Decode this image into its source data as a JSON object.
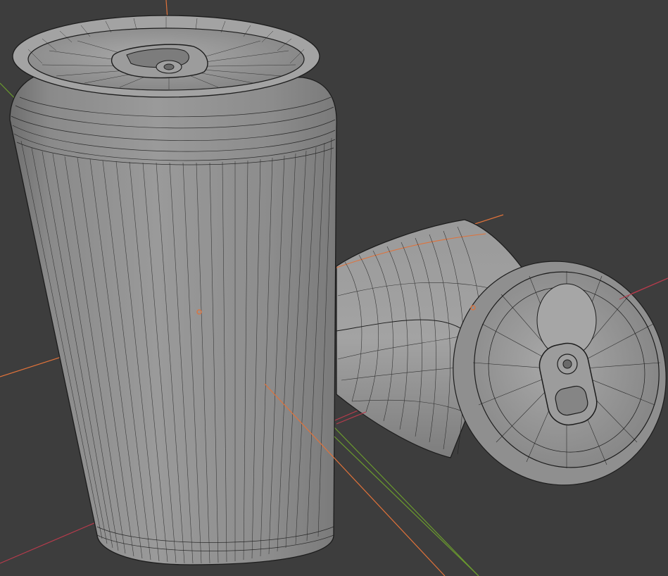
{
  "viewport": {
    "background": "#3d3d3d",
    "axis_colors": {
      "x_axis": "#b63b4c",
      "y_axis": "#6a9a2e",
      "object_axis": "#e0723a"
    },
    "mesh_fill": "#8f8f8f",
    "wire_color": "#1c1c1c",
    "origin_color": "#e0723a"
  },
  "scene": {
    "objects": [
      {
        "name": "upright-can",
        "orientation": "standing",
        "shading": "solid",
        "overlay": "wireframe"
      },
      {
        "name": "fallen-can",
        "orientation": "lying-on-side",
        "shading": "solid",
        "overlay": "wireframe",
        "deformed": "crushed"
      }
    ]
  }
}
